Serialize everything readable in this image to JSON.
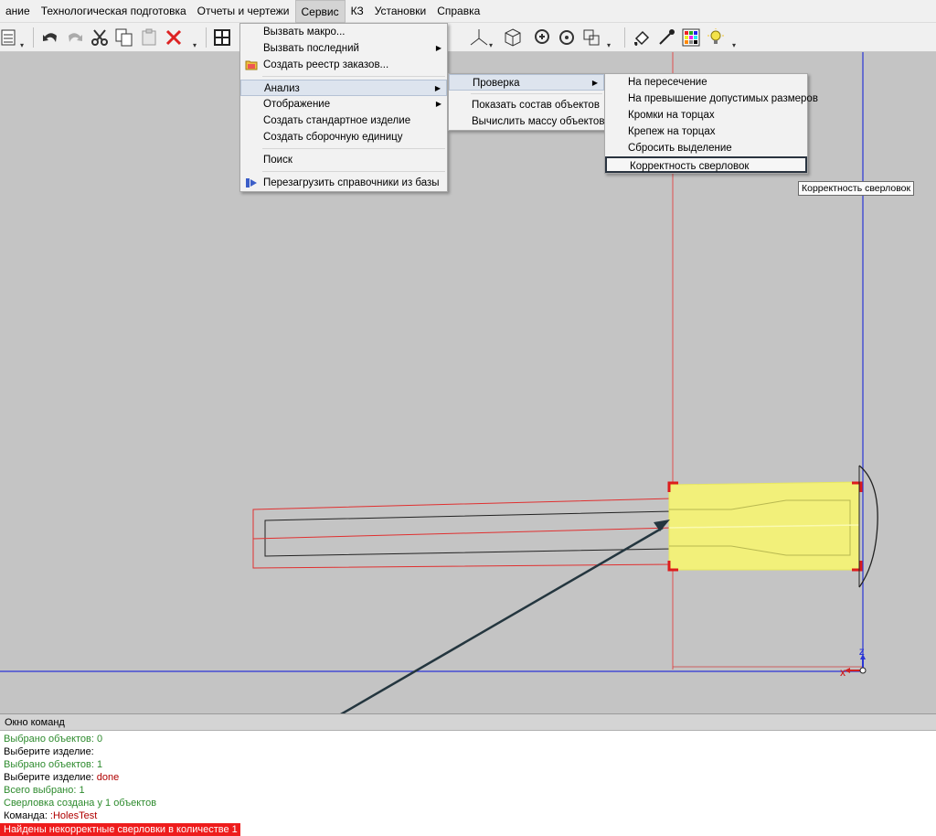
{
  "menubar": {
    "items": [
      "ание",
      "Технологическая подготовка",
      "Отчеты и чертежи",
      "Сервис",
      "КЗ",
      "Установки",
      "Справка"
    ],
    "active_index": 3
  },
  "toolbar": {
    "icons": [
      "list-icon",
      "undo-icon",
      "redo-icon",
      "cut-icon",
      "copy-icon",
      "paste-icon",
      "delete-icon",
      "grid-icon",
      "axes-icon",
      "cube-icon",
      "zoom-icon",
      "rotate-icon",
      "fit-icon",
      "paint-icon",
      "pipette-icon",
      "palette-icon",
      "bulb-icon"
    ]
  },
  "service_menu": {
    "items": [
      {
        "label": "Вызвать макро...",
        "submenu": false,
        "icon": null
      },
      {
        "label": "Вызвать последний",
        "submenu": true,
        "icon": null
      },
      {
        "label": "Создать реестр заказов...",
        "submenu": false,
        "icon": "folder-icon"
      },
      {
        "label": "Анализ",
        "submenu": true,
        "icon": null,
        "highlighted": true
      },
      {
        "label": "Отображение",
        "submenu": true,
        "icon": null
      },
      {
        "label": "Создать стандартное изделие",
        "submenu": false,
        "icon": null
      },
      {
        "label": "Создать сборочную единицу",
        "submenu": false,
        "icon": null
      },
      {
        "label": "Поиск",
        "submenu": false,
        "icon": null
      },
      {
        "label": "Перезагрузить справочники из базы",
        "submenu": false,
        "icon": "reload-icon"
      }
    ]
  },
  "analysis_menu": {
    "items": [
      {
        "label": "Проверка",
        "submenu": true,
        "highlighted": true
      },
      {
        "label": "Показать состав объектов",
        "submenu": false
      },
      {
        "label": "Вычислить массу объектов",
        "submenu": false
      }
    ]
  },
  "check_menu": {
    "items": [
      {
        "label": "На пересечение"
      },
      {
        "label": "На превышение допустимых размеров"
      },
      {
        "label": "Кромки на торцах"
      },
      {
        "label": "Крепеж на торцах"
      },
      {
        "label": "Сбросить выделение"
      },
      {
        "label": "Корректность сверловок",
        "boxed": true
      }
    ]
  },
  "tooltip": "Корректность сверловок",
  "axis_labels": {
    "z": "Z",
    "x": "X"
  },
  "command_window": {
    "title": "Окно команд",
    "lines": [
      {
        "text": "Выбрано объектов: 0",
        "style": "green"
      },
      {
        "text": "Выберите изделие:",
        "style": "black"
      },
      {
        "text": "Выбрано объектов: 1",
        "style": "green"
      },
      {
        "text": "Выберите изделие:",
        "style": "black",
        "suffix": "done"
      },
      {
        "text": "Всего выбрано: 1",
        "style": "green"
      },
      {
        "text": "Сверловка создана у 1 объектов",
        "style": "green"
      },
      {
        "text": "Команда:",
        "style": "black",
        "suffix": ":HolesTest"
      },
      {
        "text": "Найдены некорректные сверловки в количестве 1",
        "style": "err"
      }
    ]
  },
  "colors": {
    "viewport_bg": "#c4c4c4",
    "selection_fill": "#f2f07a",
    "red_outline": "#e33",
    "blue_axis": "#2030d0",
    "error_bg": "#ee1c1c"
  }
}
